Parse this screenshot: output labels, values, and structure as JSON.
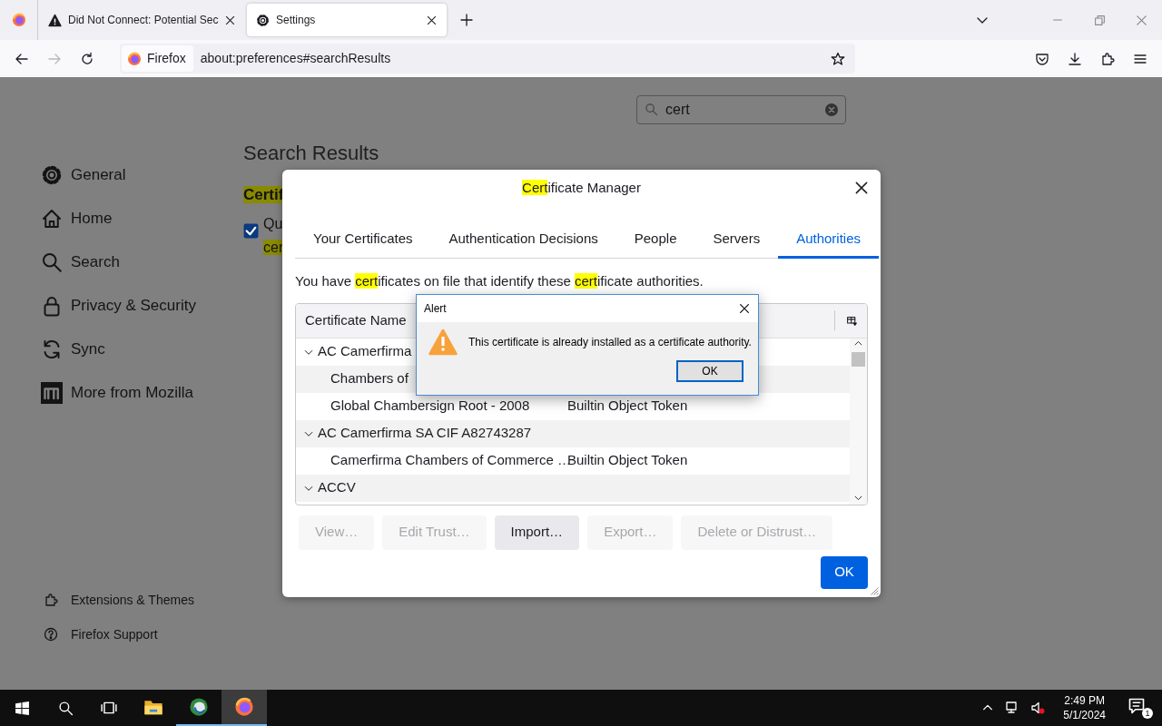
{
  "browser_tabs": [
    {
      "title": "Did Not Connect: Potential Sec",
      "selected": false
    },
    {
      "title": "Settings",
      "selected": true
    }
  ],
  "toolbar": {
    "identity": "Firefox",
    "url": "about:preferences#searchResults",
    "forward_disabled": true
  },
  "sidebar": {
    "items": [
      {
        "label": "General"
      },
      {
        "label": "Home"
      },
      {
        "label": "Search"
      },
      {
        "label": "Privacy & Security"
      },
      {
        "label": "Sync"
      },
      {
        "label": "More from Mozilla"
      }
    ],
    "footer": [
      {
        "label": "Extensions & Themes"
      },
      {
        "label": "Firefox Support"
      }
    ]
  },
  "search": {
    "value": "cert"
  },
  "results": {
    "heading": "Search Results",
    "group_title": {
      "text": "Certif",
      "highlighted": true
    },
    "option": {
      "checked": true,
      "lines": [
        {
          "text": "Qu",
          "highlighted": false
        },
        {
          "text": "cer",
          "highlighted": true
        }
      ]
    }
  },
  "certificate_manager": {
    "title": [
      {
        "text": "Cert",
        "highlighted": true
      },
      {
        "text": "ificate Manager",
        "highlighted": false
      }
    ],
    "tabs": [
      {
        "label": "Your Certificates",
        "selected": false
      },
      {
        "label": "Authentication Decisions",
        "selected": false
      },
      {
        "label": "People",
        "selected": false
      },
      {
        "label": "Servers",
        "selected": false
      },
      {
        "label": "Authorities",
        "selected": true
      }
    ],
    "description": [
      {
        "text": "You have ",
        "highlighted": false
      },
      {
        "text": "cert",
        "highlighted": true
      },
      {
        "text": "ificates on file that identify these ",
        "highlighted": false
      },
      {
        "text": "cert",
        "highlighted": true
      },
      {
        "text": "ificate authorities.",
        "highlighted": false
      }
    ],
    "columns": [
      "Certificate Name"
    ],
    "tree": [
      {
        "name": "AC Camerfirma",
        "expanded": true,
        "children": [
          {
            "name": "Chambers of"
          },
          {
            "name": "Global Chambersign Root - 2008",
            "device": "Builtin Object Token"
          }
        ]
      },
      {
        "name": "AC Camerfirma SA CIF A82743287",
        "expanded": true,
        "children": [
          {
            "name": "Camerfirma Chambers of Commerce …",
            "device": "Builtin Object Token"
          }
        ]
      },
      {
        "name": "ACCV",
        "expanded": true
      }
    ],
    "buttons": [
      {
        "label": "View…",
        "disabled": true
      },
      {
        "label": "Edit Trust…",
        "disabled": true
      },
      {
        "label": "Import…",
        "disabled": false
      },
      {
        "label": "Export…",
        "disabled": true
      },
      {
        "label": "Delete or Distrust…",
        "disabled": true
      }
    ],
    "ok": "OK"
  },
  "alert": {
    "title": "Alert",
    "message": "This certificate is already installed as a certificate authority.",
    "ok": "OK"
  },
  "taskbar": {
    "apps": [
      {
        "kind": "explorer",
        "running": false,
        "selected": false
      },
      {
        "kind": "globe",
        "running": true,
        "selected": false
      },
      {
        "kind": "firefox",
        "running": true,
        "selected": true
      }
    ],
    "time": "2:49 PM",
    "date": "5/1/2024",
    "notifications": "1"
  }
}
